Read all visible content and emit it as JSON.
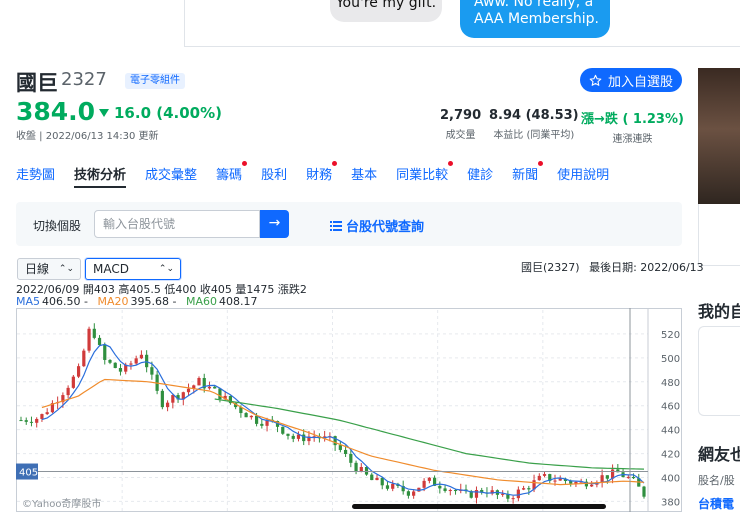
{
  "ad": {
    "bubble_left": "You're my gift.",
    "bubble_right_line1": "Aww. No really, a",
    "bubble_right_line2": "AAA Membership."
  },
  "stock": {
    "name": "國巨",
    "code": "2327",
    "category": "電子零組件",
    "price": "384.0",
    "change": "16.0 (4.00%)",
    "close_time": "收盤 | 2022/06/13 14:30 更新",
    "add_watchlist": "加入自選股",
    "stats": [
      {
        "value": "2,790",
        "label": "成交量"
      },
      {
        "value": "8.94 (48.53)",
        "label": "本益比 (同業平均)"
      },
      {
        "value": "漲→跌 ↑ 1.23%)",
        "label": "連漲連跌"
      }
    ],
    "stat_parts": {
      "streak_a": "漲→跌",
      "streak_b": "( ",
      "streak_pct": "1.23%)"
    }
  },
  "tabs": [
    {
      "label": "走勢圖",
      "dot": false
    },
    {
      "label": "技術分析",
      "dot": false,
      "active": true
    },
    {
      "label": "成交彙整",
      "dot": false
    },
    {
      "label": "籌碼",
      "dot": true
    },
    {
      "label": "股利",
      "dot": false
    },
    {
      "label": "財務",
      "dot": true
    },
    {
      "label": "基本",
      "dot": false
    },
    {
      "label": "同業比較",
      "dot": true
    },
    {
      "label": "健診",
      "dot": false
    },
    {
      "label": "新聞",
      "dot": true
    },
    {
      "label": "使用說明",
      "dot": false
    }
  ],
  "search": {
    "label": "切換個股",
    "placeholder": "輸入台股代號",
    "go": "→",
    "code_lookup": "台股代號查詢"
  },
  "controls": {
    "period": "日線",
    "indicator": "MACD"
  },
  "chart_meta": {
    "stock": "國巨(2327)",
    "last_date": "最後日期: 2022/06/13"
  },
  "ohlc": "2022/06/09 開403 高405.5 低400 收405 量1475 漲跌2",
  "ma": [
    {
      "label": "MA5",
      "value": "406.50 -",
      "color": "#2b6fdc"
    },
    {
      "label": "MA20",
      "value": "395.68 -",
      "color": "#f08c2d"
    },
    {
      "label": "MA60",
      "value": "408.17",
      "color": "#3aa04a"
    }
  ],
  "watermark": "©Yahoo奇摩股市",
  "crosshair_price": "405",
  "right_column": {
    "title1": "我的自",
    "title2": "網友也",
    "sub": "股名/股",
    "item": "台積電"
  },
  "chart_data": {
    "type": "candlestick",
    "y_ticks": [
      380,
      400,
      420,
      440,
      460,
      480,
      500,
      520
    ],
    "ylim": [
      372,
      540
    ],
    "n_candles": 120,
    "anchors": [
      [
        0,
        448
      ],
      [
        6,
        450
      ],
      [
        12,
        468
      ],
      [
        18,
        488
      ],
      [
        22,
        528
      ],
      [
        26,
        498
      ],
      [
        32,
        488
      ],
      [
        38,
        505
      ],
      [
        44,
        462
      ],
      [
        50,
        470
      ],
      [
        56,
        480
      ],
      [
        62,
        470
      ],
      [
        68,
        458
      ],
      [
        74,
        448
      ],
      [
        80,
        445
      ],
      [
        86,
        432
      ],
      [
        92,
        435
      ],
      [
        98,
        430
      ],
      [
        104,
        412
      ],
      [
        110,
        398
      ],
      [
        116,
        392
      ],
      [
        122,
        388
      ],
      [
        128,
        397
      ],
      [
        134,
        392
      ],
      [
        140,
        385
      ],
      [
        146,
        390
      ],
      [
        152,
        382
      ],
      [
        158,
        390
      ],
      [
        164,
        400
      ],
      [
        170,
        398
      ],
      [
        176,
        395
      ],
      [
        182,
        400
      ],
      [
        188,
        404
      ],
      [
        192,
        398
      ],
      [
        196,
        386
      ]
    ],
    "ma20": [
      [
        6,
        458
      ],
      [
        18,
        468
      ],
      [
        26,
        482
      ],
      [
        40,
        480
      ],
      [
        60,
        472
      ],
      [
        74,
        452
      ],
      [
        90,
        438
      ],
      [
        110,
        418
      ],
      [
        130,
        406
      ],
      [
        150,
        398
      ],
      [
        170,
        394
      ],
      [
        190,
        397
      ],
      [
        196,
        396
      ]
    ],
    "ma60": [
      [
        60,
        466
      ],
      [
        80,
        458
      ],
      [
        100,
        448
      ],
      [
        120,
        434
      ],
      [
        140,
        420
      ],
      [
        160,
        412
      ],
      [
        180,
        408
      ],
      [
        196,
        407
      ]
    ],
    "crosshair_value": 405
  }
}
